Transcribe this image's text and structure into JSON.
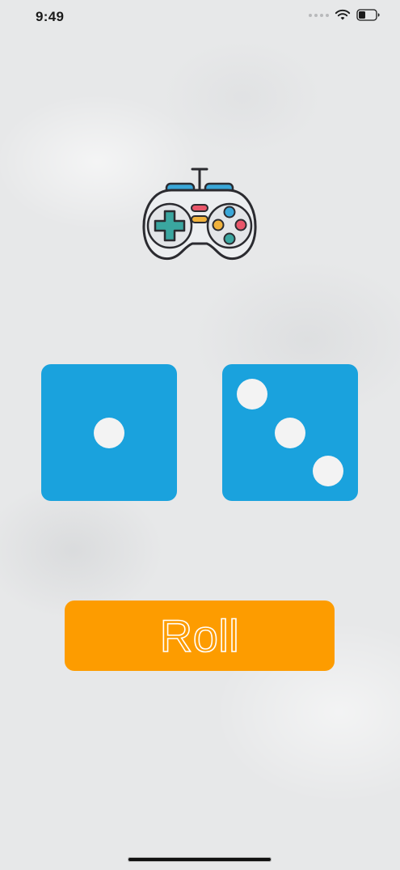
{
  "status_bar": {
    "time": "9:49",
    "icons": [
      "signal-dots-icon",
      "wifi-icon",
      "battery-icon"
    ]
  },
  "logo": {
    "icon": "gamepad-icon"
  },
  "dice": [
    {
      "value": 1,
      "color": "#1aa2dd"
    },
    {
      "value": 3,
      "color": "#1aa2dd"
    }
  ],
  "roll_button": {
    "label": "Roll",
    "color": "#fd9c00"
  }
}
